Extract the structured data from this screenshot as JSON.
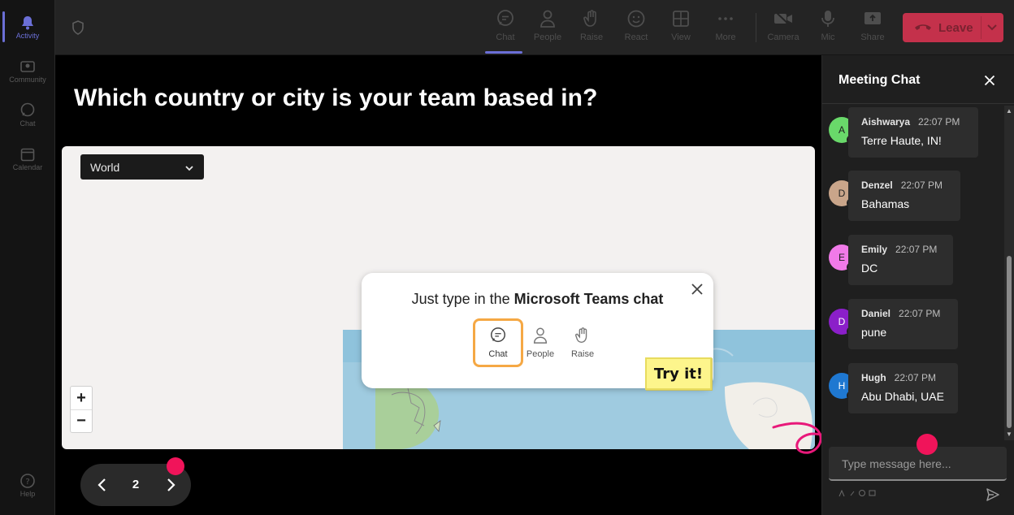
{
  "rail": {
    "items": [
      {
        "label": "Activity",
        "icon": "bell-icon"
      },
      {
        "label": "Community",
        "icon": "community-icon"
      },
      {
        "label": "Chat",
        "icon": "chat-icon"
      },
      {
        "label": "Calendar",
        "icon": "calendar-icon"
      }
    ],
    "help_label": "Help"
  },
  "toolbar": {
    "buttons": [
      {
        "label": "Chat",
        "icon": "chat-icon",
        "active": true
      },
      {
        "label": "People",
        "icon": "people-icon"
      },
      {
        "label": "Raise",
        "icon": "raise-hand-icon"
      },
      {
        "label": "React",
        "icon": "smiley-icon"
      },
      {
        "label": "View",
        "icon": "grid-icon"
      },
      {
        "label": "More",
        "icon": "more-icon"
      },
      {
        "label": "Camera",
        "icon": "camera-off-icon"
      },
      {
        "label": "Mic",
        "icon": "mic-icon"
      },
      {
        "label": "Share",
        "icon": "share-icon"
      }
    ],
    "leave_label": "Leave",
    "leave_color": "#c4314b"
  },
  "stage": {
    "question": "Which country or city is your team based in?",
    "region_select": "World",
    "zoom_in": "+",
    "zoom_out": "−",
    "tip": {
      "text_prefix": "Just type in the ",
      "text_bold": "Microsoft Teams chat",
      "icons": [
        {
          "label": "Chat",
          "icon": "chat-icon",
          "highlighted": true
        },
        {
          "label": "People",
          "icon": "people-icon"
        },
        {
          "label": "Raise",
          "icon": "raise-hand-icon"
        }
      ]
    },
    "try_it": "Try it!",
    "pager": {
      "current": "2"
    }
  },
  "chat": {
    "title": "Meeting Chat",
    "messages": [
      {
        "initial": "A",
        "name": "Aishwarya",
        "time": "22:07 PM",
        "text": "Terre Haute, IN!",
        "color": "#69d96a"
      },
      {
        "initial": "D",
        "name": "Denzel",
        "time": "22:07 PM",
        "text": "Bahamas",
        "color": "#c9a58a"
      },
      {
        "initial": "E",
        "name": "Emily",
        "time": "22:07 PM",
        "text": "DC",
        "color": "#f07ae8"
      },
      {
        "initial": "D",
        "name": "Daniel",
        "time": "22:07 PM",
        "text": "pune",
        "color": "#8b1fc9"
      },
      {
        "initial": "H",
        "name": "Hugh",
        "time": "22:07 PM",
        "text": "Abu Dhabi, UAE",
        "color": "#1f78d1"
      }
    ],
    "compose_placeholder": "Type message here...",
    "accent": "#6b6fd6",
    "highlight_dot": "#f0145a"
  }
}
